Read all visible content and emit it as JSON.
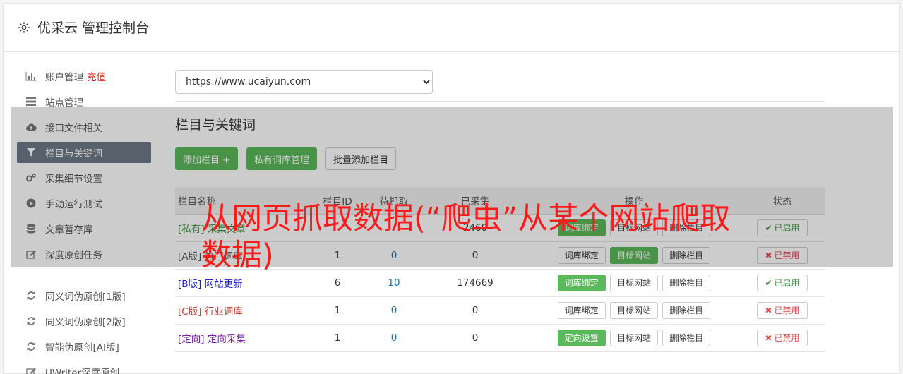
{
  "header": {
    "title": "优采云 管理控制台",
    "icon": "gear-icon"
  },
  "sidebar": {
    "recharge": "充值",
    "items": [
      {
        "label": "账户管理",
        "icon": "bar-chart-icon"
      },
      {
        "label": "站点管理",
        "icon": "server-icon"
      },
      {
        "label": "接口文件相关",
        "icon": "cloud-upload-icon"
      },
      {
        "label": "栏目与关键词",
        "icon": "filter-icon",
        "active": true
      },
      {
        "label": "采集细节设置",
        "icon": "cogs-icon"
      },
      {
        "label": "手动运行测试",
        "icon": "play-circle-icon"
      },
      {
        "label": "文章暂存库",
        "icon": "database-icon"
      },
      {
        "label": "深度原创任务",
        "icon": "edit-icon"
      }
    ],
    "items2": [
      {
        "label": "同义词伪原创[1版]",
        "icon": "refresh-icon"
      },
      {
        "label": "同义词伪原创[2版]",
        "icon": "refresh-icon"
      },
      {
        "label": "智能伪原创[AI版]",
        "icon": "refresh-icon"
      },
      {
        "label": "UWriter深度原创",
        "icon": "edit-icon"
      }
    ]
  },
  "main": {
    "site_select": "https://www.ucaiyun.com",
    "section_title": "栏目与关键词",
    "buttons": {
      "add_column": "添加栏目 +",
      "private_lib": "私有词库管理",
      "batch_add": "批量添加栏目"
    },
    "table": {
      "headers": {
        "name": "栏目名称",
        "id": "栏目ID",
        "pending": "待抓取",
        "collected": "已采集",
        "ops": "操作",
        "status": "状态"
      },
      "ops": {
        "bind": "词库绑定",
        "target": "目标网站",
        "delete": "删除栏目",
        "directed": "定向设置"
      },
      "status_on": "已启用",
      "status_off": "已禁用",
      "rows": [
        {
          "prefix": "[私有]",
          "name": "采集文章",
          "id": "",
          "pending": "",
          "collected": "2460",
          "first_btn": "词库绑定",
          "first_green": true,
          "second_green": false,
          "enabled": true
        },
        {
          "prefix": "[A版]",
          "name": "热门词库",
          "id": "1",
          "pending": "0",
          "collected": "0",
          "first_btn": "词库绑定",
          "first_green": false,
          "second_green": true,
          "enabled": false
        },
        {
          "prefix": "[B版]",
          "name": "网站更新",
          "id": "6",
          "pending": "10",
          "collected": "174669",
          "first_btn": "词库绑定",
          "first_green": true,
          "second_green": false,
          "enabled": true
        },
        {
          "prefix": "[C版]",
          "name": "行业词库",
          "id": "1",
          "pending": "0",
          "collected": "0",
          "first_btn": "词库绑定",
          "first_green": false,
          "second_green": false,
          "enabled": false
        },
        {
          "prefix": "[定向]",
          "name": "定向采集",
          "id": "1",
          "pending": "0",
          "collected": "0",
          "first_btn": "定向设置",
          "first_green": true,
          "second_green": false,
          "enabled": false
        }
      ]
    }
  },
  "watermark": "从网页抓取数据(“爬虫”从某个网站爬取数据)"
}
